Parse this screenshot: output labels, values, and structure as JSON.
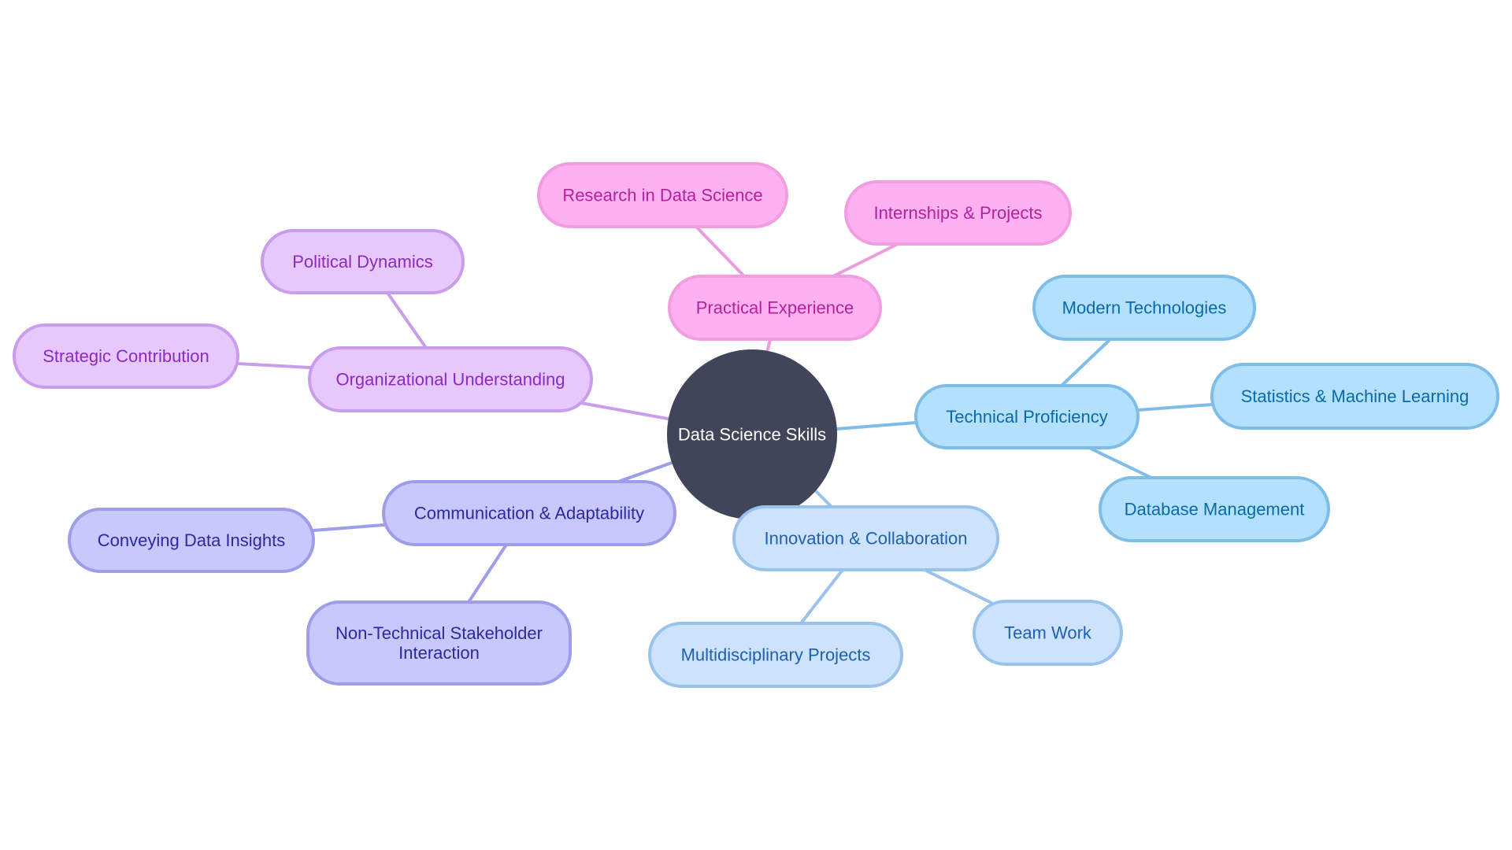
{
  "diagram": {
    "type": "mindmap",
    "root": {
      "id": "root",
      "label": "Data Science Skills",
      "fill": "#414559",
      "text_color": "#ffffff"
    },
    "branches": [
      {
        "id": "practical",
        "label": "Practical Experience",
        "theme": {
          "fill": "#fdb1f0",
          "stroke": "#f19de0",
          "text": "#b5219b",
          "edge": "#ec9bde"
        },
        "children": [
          {
            "id": "research",
            "label": "Research in Data Science"
          },
          {
            "id": "internships",
            "label": "Internships & Projects"
          }
        ]
      },
      {
        "id": "technical",
        "label": "Technical Proficiency",
        "theme": {
          "fill": "#b3e0fd",
          "stroke": "#7fbde9",
          "text": "#0a6aa8",
          "edge": "#7fbde9"
        },
        "children": [
          {
            "id": "modern",
            "label": "Modern Technologies"
          },
          {
            "id": "statsml",
            "label": "Statistics & Machine Learning"
          },
          {
            "id": "database",
            "label": "Database Management"
          }
        ]
      },
      {
        "id": "innovation",
        "label": "Innovation & Collaboration",
        "theme": {
          "fill": "#cce3fb",
          "stroke": "#9ac3ec",
          "text": "#1f5fae",
          "edge": "#9ac3ec"
        },
        "children": [
          {
            "id": "multidisc",
            "label": "Multidisciplinary Projects"
          },
          {
            "id": "teamwork",
            "label": "Team Work"
          }
        ]
      },
      {
        "id": "communication",
        "label": "Communication & Adaptability",
        "theme": {
          "fill": "#c8c8fc",
          "stroke": "#9d9de9",
          "text": "#2a2aa0",
          "edge": "#9d9de9"
        },
        "children": [
          {
            "id": "conveying",
            "label": "Conveying Data Insights"
          },
          {
            "id": "nontech",
            "label": "Non-Technical Stakeholder Interaction",
            "lines": [
              "Non-Technical Stakeholder",
              "Interaction"
            ]
          }
        ]
      },
      {
        "id": "organizational",
        "label": "Organizational Understanding",
        "theme": {
          "fill": "#e7c8fc",
          "stroke": "#c99cec",
          "text": "#8a2ac0",
          "edge": "#c99cec"
        },
        "children": [
          {
            "id": "political",
            "label": "Political Dynamics"
          },
          {
            "id": "strategic",
            "label": "Strategic Contribution"
          }
        ]
      }
    ]
  }
}
